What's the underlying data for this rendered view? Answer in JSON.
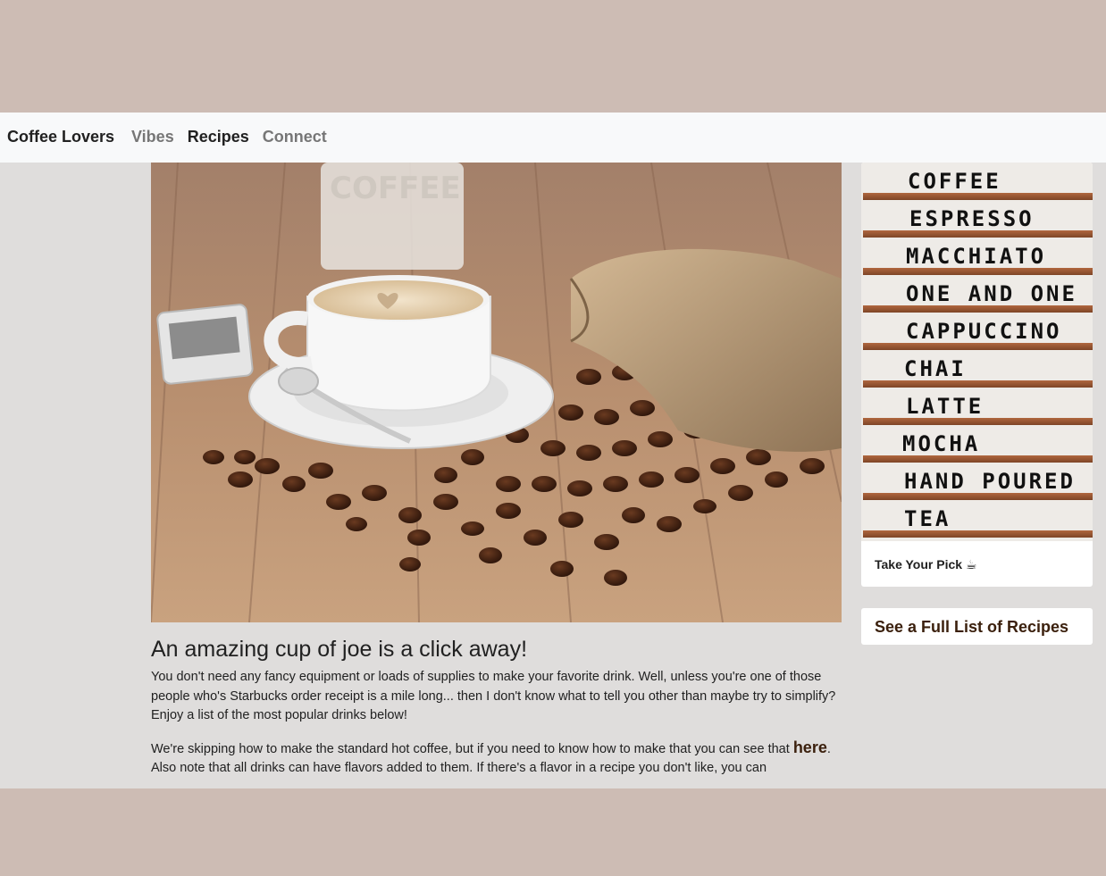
{
  "navbar": {
    "brand": "Coffee Lovers",
    "links": [
      {
        "label": "Vibes",
        "active": false
      },
      {
        "label": "Recipes",
        "active": true
      },
      {
        "label": "Connect",
        "active": false
      }
    ]
  },
  "hero": {
    "mug_text": "COFFEE",
    "icons": [
      "coffee-cup-photo"
    ]
  },
  "sidebar": {
    "menu_board": [
      "COFFEE",
      "ESPRESSO",
      "MACCHIATO",
      "ONE AND ONE",
      "CAPPUCCINO",
      "CHAI",
      "LATTE",
      "MOCHA",
      "HAND POURED",
      "TEA"
    ],
    "card_caption": "Take Your Pick ☕",
    "recipes_button": "See a Full List of Recipes"
  },
  "article": {
    "heading": "An amazing cup of joe is a click away!",
    "paragraph1": "You don't need any fancy equipment or loads of supplies to make your favorite drink. Well, unless you're one of those people who's Starbucks order receipt is a mile long... then I don't know what to tell you other than maybe try to simplify? Enjoy a list of the most popular drinks below!",
    "paragraph2_start": "We're skipping how to make the standard hot coffee, but if you need to know how to make that you can see that ",
    "paragraph2_link": "here",
    "paragraph2_end": ". Also note that all drinks can have flavors added to them. If there's a flavor in a recipe you don't like, you can"
  },
  "colors": {
    "page_background": "#cdbcb4",
    "content_background": "#dfdddc",
    "navbar_background": "#f8f9fa",
    "link_accent": "#3b200d"
  }
}
